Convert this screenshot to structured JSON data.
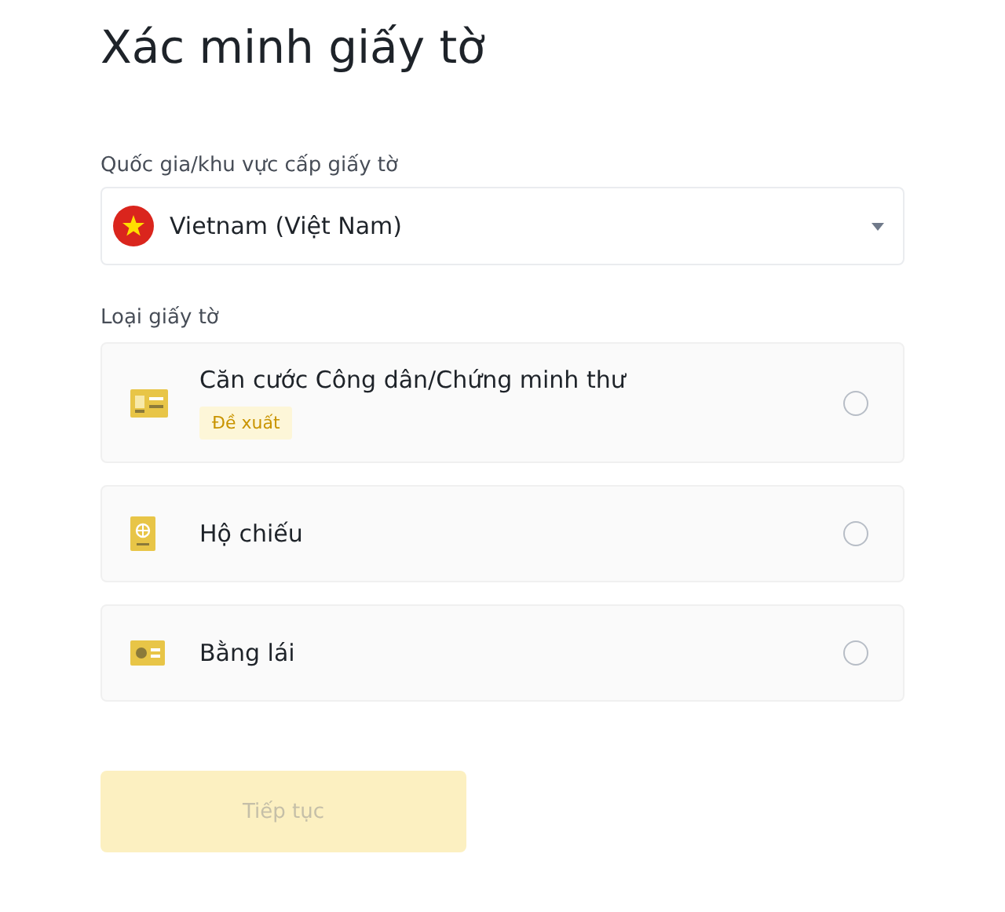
{
  "title": "Xác minh giấy tờ",
  "country": {
    "label": "Quốc gia/khu vực cấp giấy tờ",
    "value": "Vietnam (Việt Nam)"
  },
  "document_type": {
    "label": "Loại giấy tờ",
    "options": [
      {
        "kind": "id-card",
        "label": "Căn cước Công dân/Chứng minh thư",
        "badge": "Đề xuất",
        "selected": false
      },
      {
        "kind": "passport",
        "label": "Hộ chiếu",
        "selected": false
      },
      {
        "kind": "license",
        "label": "Bằng lái",
        "selected": false
      }
    ]
  },
  "continue_button": {
    "label": "Tiếp tục",
    "disabled": true
  }
}
